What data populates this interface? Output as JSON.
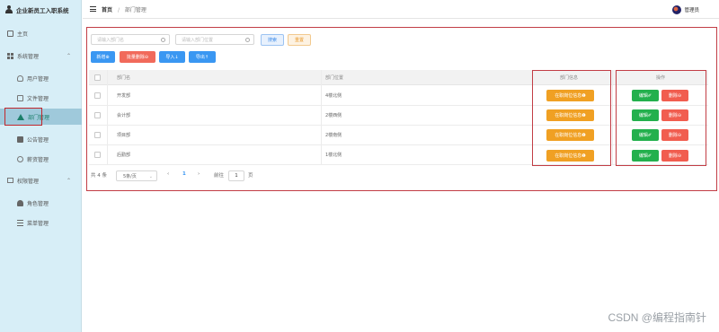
{
  "app": {
    "title": "企业新员工入职系统"
  },
  "header": {
    "breadcrumb_home": "首页",
    "breadcrumb_sep": "/",
    "breadcrumb_current": "部门管理",
    "user_name": "管理员"
  },
  "sidebar": {
    "items": [
      {
        "label": "主页",
        "icon": "home-icon"
      },
      {
        "label": "系统管理",
        "icon": "grid-icon",
        "expanded": true
      },
      {
        "label": "用户管理",
        "icon": "user-icon"
      },
      {
        "label": "文件管理",
        "icon": "doc-icon"
      },
      {
        "label": "部门管理",
        "icon": "house-icon",
        "active": true
      },
      {
        "label": "公告管理",
        "icon": "chat-icon"
      },
      {
        "label": "薪资管理",
        "icon": "coin-icon"
      },
      {
        "label": "权限管理",
        "icon": "monitor-icon",
        "expanded": true
      },
      {
        "label": "角色管理",
        "icon": "person-icon"
      },
      {
        "label": "菜单管理",
        "icon": "menu-icon"
      }
    ]
  },
  "search": {
    "name_placeholder": "请输入部门名",
    "location_placeholder": "请输入部门位置",
    "search_label": "搜索",
    "reset_label": "重置"
  },
  "toolbar": {
    "add_label": "新增⊕",
    "batch_delete_label": "批量删除⊖",
    "import_label": "导入↓",
    "export_label": "导出↑"
  },
  "table": {
    "headers": [
      "部门名",
      "部门位置",
      "部门信息",
      "操作"
    ],
    "rows": [
      {
        "name": "开发部",
        "location": "4楼北侧"
      },
      {
        "name": "会计部",
        "location": "2楼西侧"
      },
      {
        "name": "项目部",
        "location": "2楼南侧"
      },
      {
        "name": "后勤部",
        "location": "1楼北侧"
      }
    ],
    "info_button_label": "在职岗位信息❶",
    "edit_button_label": "编辑✐",
    "delete_button_label": "删除⊖"
  },
  "pagination": {
    "total_text": "共 4 条",
    "page_size": "5条/页",
    "prev": "‹",
    "current_page": "1",
    "next": "›",
    "goto_prefix": "前往",
    "goto_value": "1",
    "goto_suffix": "页"
  },
  "watermark": "CSDN @编程指南针",
  "colors": {
    "sidebar_bg": "#d7eef7",
    "primary_blue": "#3a97f2",
    "danger_red": "#f16a5b",
    "orange": "#f0a023",
    "green": "#23b04d",
    "highlight_frame": "#c23d45"
  }
}
